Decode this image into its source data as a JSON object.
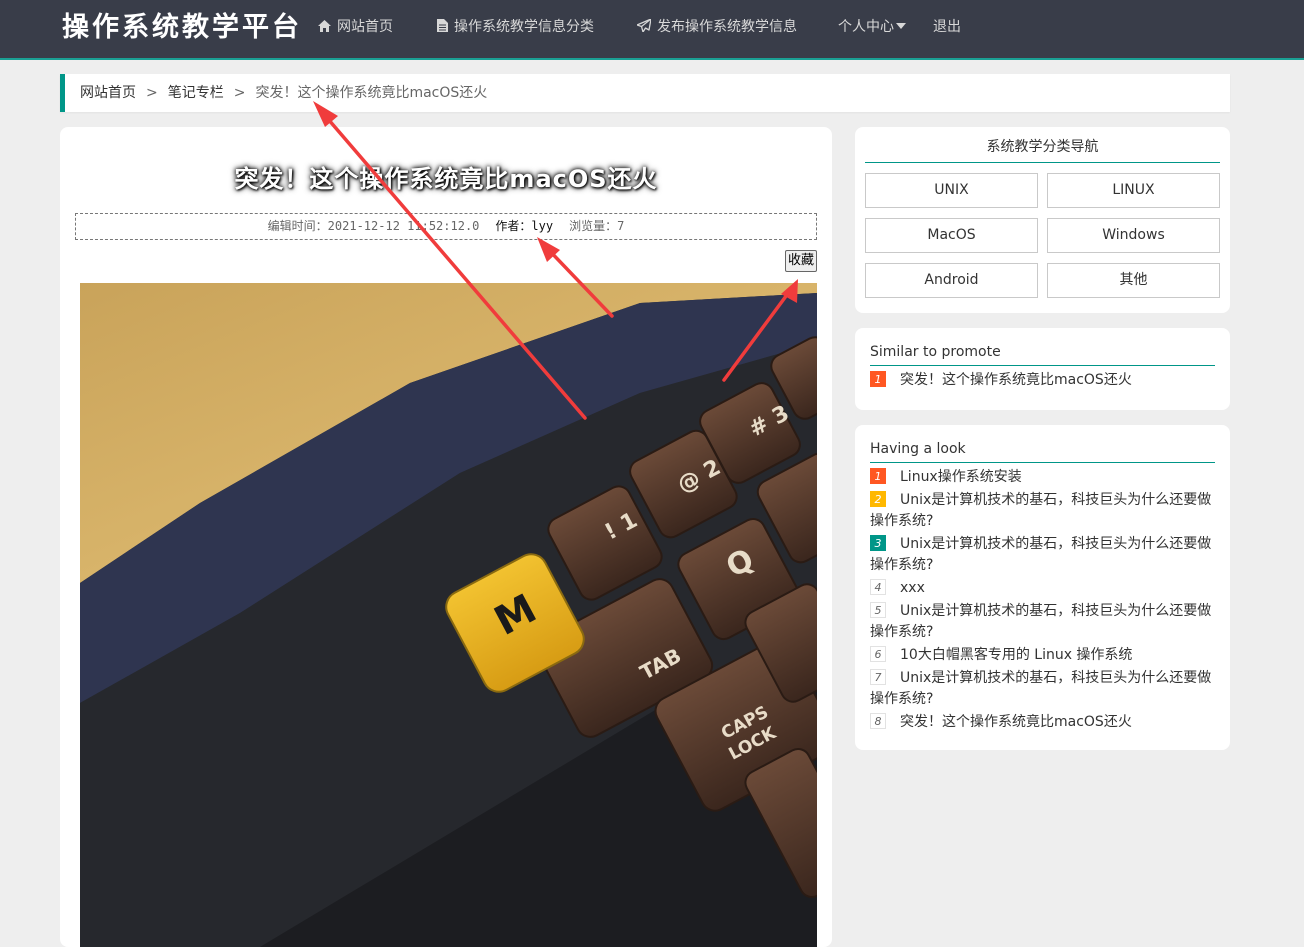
{
  "brand": "操作系统教学平台",
  "nav": {
    "home": "网站首页",
    "categories": "操作系统教学信息分类",
    "publish": "发布操作系统教学信息",
    "profile": "个人中心",
    "logout": "退出"
  },
  "breadcrumb": {
    "home": "网站首页",
    "sep": ">",
    "section": "笔记专栏",
    "current": "突发！这个操作系统竟比macOS还火"
  },
  "article": {
    "title": "突发！这个操作系统竟比macOS还火",
    "edit_time_label": "编辑时间：",
    "edit_time": "2021-12-12 11:52:12.0",
    "author_label": "作者：",
    "author": "lyy",
    "views_label": "浏览量：",
    "views": "7",
    "favorite_label": "收藏",
    "image_alt": "keyboard photo"
  },
  "category_nav": {
    "title": "系统教学分类导航",
    "items": [
      "UNIX",
      "LINUX",
      "MacOS",
      "Windows",
      "Android",
      "其他"
    ]
  },
  "similar": {
    "title": "Similar to promote",
    "items": [
      {
        "num": "1",
        "text": "突发！这个操作系统竟比macOS还火"
      }
    ]
  },
  "having_look": {
    "title": "Having a look",
    "items": [
      {
        "num": "1",
        "text": "Linux操作系统安装"
      },
      {
        "num": "2",
        "text": "Unix是计算机技术的基石，科技巨头为什么还要做操作系统?"
      },
      {
        "num": "3",
        "text": "Unix是计算机技术的基石，科技巨头为什么还要做操作系统?"
      },
      {
        "num": "4",
        "text": "xxx"
      },
      {
        "num": "5",
        "text": "Unix是计算机技术的基石，科技巨头为什么还要做操作系统?"
      },
      {
        "num": "6",
        "text": "10大白帽黑客专用的 Linux 操作系统"
      },
      {
        "num": "7",
        "text": "Unix是计算机技术的基石，科技巨头为什么还要做操作系统?"
      },
      {
        "num": "8",
        "text": "突发！这个操作系统竟比macOS还火"
      }
    ]
  },
  "colors": {
    "nav_bg": "#393d49",
    "accent": "#009688",
    "rank1": "#ff5722",
    "rank2": "#ffb800",
    "rank3": "#009688",
    "annotation_arrow": "#f03c3c"
  },
  "icons": {
    "home": "home-icon",
    "categories": "file-icon",
    "publish": "paper-plane-icon",
    "profile": "caret-down-icon"
  }
}
